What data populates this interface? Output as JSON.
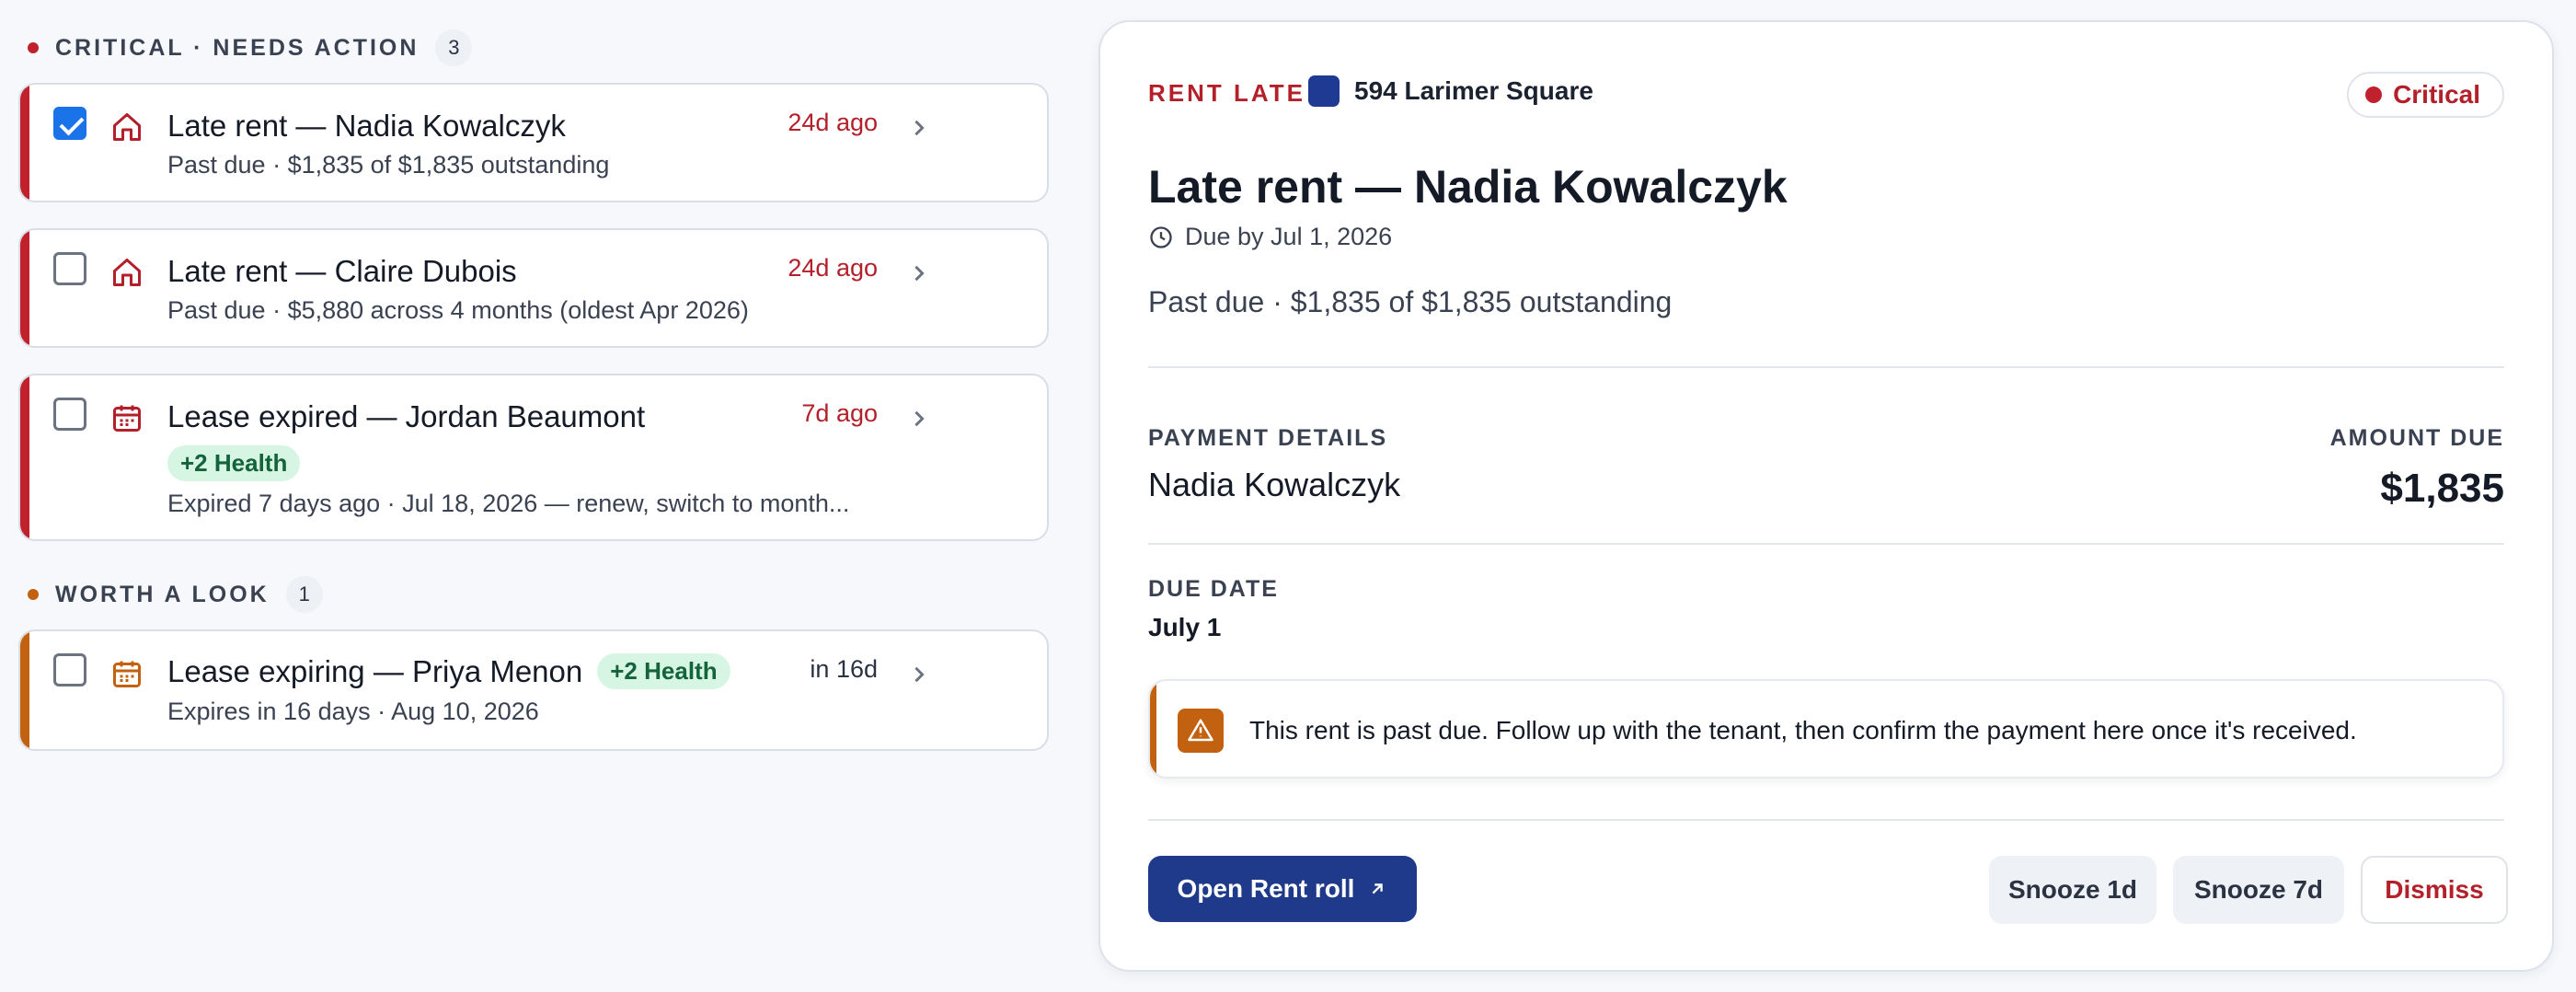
{
  "colors": {
    "critical": "#c0212c",
    "warning": "#c2610f",
    "primary": "#1f3a8a",
    "health_bg": "#d6f5e3",
    "health_text": "#14633a",
    "property_swatch": "#1f3a93"
  },
  "sections": [
    {
      "label": "CRITICAL · NEEDS ACTION",
      "count": "3",
      "items": [
        {
          "checked": true,
          "icon": "home-icon",
          "title": "Late rent — Nadia Kowalczyk",
          "badge": "",
          "subtitle": "Past due · $1,835 of $1,835 outstanding",
          "when": "24d ago"
        },
        {
          "checked": false,
          "icon": "home-icon",
          "title": "Late rent — Claire Dubois",
          "badge": "",
          "subtitle": "Past due · $5,880 across 4 months (oldest Apr 2026)",
          "when": "24d ago"
        },
        {
          "checked": false,
          "icon": "calendar-icon",
          "title": "Lease expired — Jordan Beaumont",
          "badge": "+2 Health",
          "subtitle": "Expired 7 days ago · Jul 18, 2026 — renew, switch to month...",
          "when": "7d ago"
        }
      ]
    },
    {
      "label": "WORTH A LOOK",
      "count": "1",
      "items": [
        {
          "checked": false,
          "icon": "calendar-icon",
          "title": "Lease expiring — Priya Menon",
          "badge": "+2 Health",
          "subtitle": "Expires in 16 days · Aug 10, 2026",
          "when": "in 16d"
        }
      ]
    }
  ],
  "detail": {
    "kind": "RENT LATE",
    "property": "594 Larimer Square",
    "severity": "Critical",
    "title": "Late rent — Nadia Kowalczyk",
    "due_by": "Due by Jul 1, 2026",
    "summary": "Past due · $1,835 of $1,835 outstanding",
    "payment_label": "PAYMENT DETAILS",
    "payment_name": "Nadia Kowalczyk",
    "amount_label": "AMOUNT DUE",
    "amount": "$1,835",
    "due_date_label": "DUE DATE",
    "due_date": "July 1",
    "notice": "This rent is past due. Follow up with the tenant, then confirm the payment here once it's received.",
    "actions": {
      "open": "Open Rent roll",
      "snooze1": "Snooze 1d",
      "snooze7": "Snooze 7d",
      "dismiss": "Dismiss"
    }
  }
}
